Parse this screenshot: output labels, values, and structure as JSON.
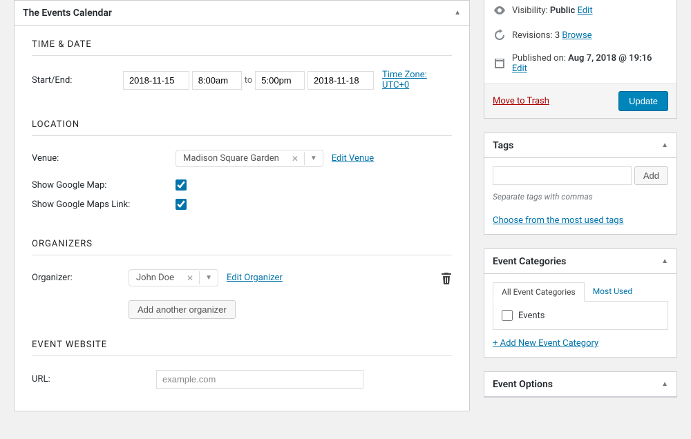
{
  "events_calendar": {
    "title": "The Events Calendar",
    "sections": {
      "time_date": {
        "heading": "TIME & DATE",
        "start_end_label": "Start/End:",
        "start_date": "2018-11-15",
        "start_time": "8:00am",
        "to_text": "to",
        "end_time": "5:00pm",
        "end_date": "2018-11-18",
        "timezone_link": "Time Zone: UTC+0"
      },
      "location": {
        "heading": "LOCATION",
        "venue_label": "Venue:",
        "venue_value": "Madison Square Garden",
        "edit_venue": "Edit Venue",
        "show_map_label": "Show Google Map:",
        "show_map_checked": true,
        "show_link_label": "Show Google Maps Link:",
        "show_link_checked": true
      },
      "organizers": {
        "heading": "ORGANIZERS",
        "organizer_label": "Organizer:",
        "organizer_value": "John Doe",
        "edit_organizer": "Edit Organizer",
        "add_another": "Add another organizer"
      },
      "website": {
        "heading": "EVENT WEBSITE",
        "url_label": "URL:",
        "url_placeholder": "example.com",
        "url_value": ""
      }
    }
  },
  "publish": {
    "visibility_label": "Visibility:",
    "visibility_value": "Public",
    "visibility_edit": "Edit",
    "revisions_label": "Revisions:",
    "revisions_count": "3",
    "revisions_browse": "Browse",
    "published_label": "Published on:",
    "published_date": "Aug 7, 2018 @ 19:16",
    "published_edit": "Edit",
    "trash": "Move to Trash",
    "update": "Update"
  },
  "tags": {
    "title": "Tags",
    "add_label": "Add",
    "hint": "Separate tags with commas",
    "choose_link": "Choose from the most used tags"
  },
  "categories": {
    "title": "Event Categories",
    "tab_all": "All Event Categories",
    "tab_most": "Most Used",
    "item_events": "Events",
    "add_new": "+ Add New Event Category"
  },
  "options": {
    "title": "Event Options"
  }
}
